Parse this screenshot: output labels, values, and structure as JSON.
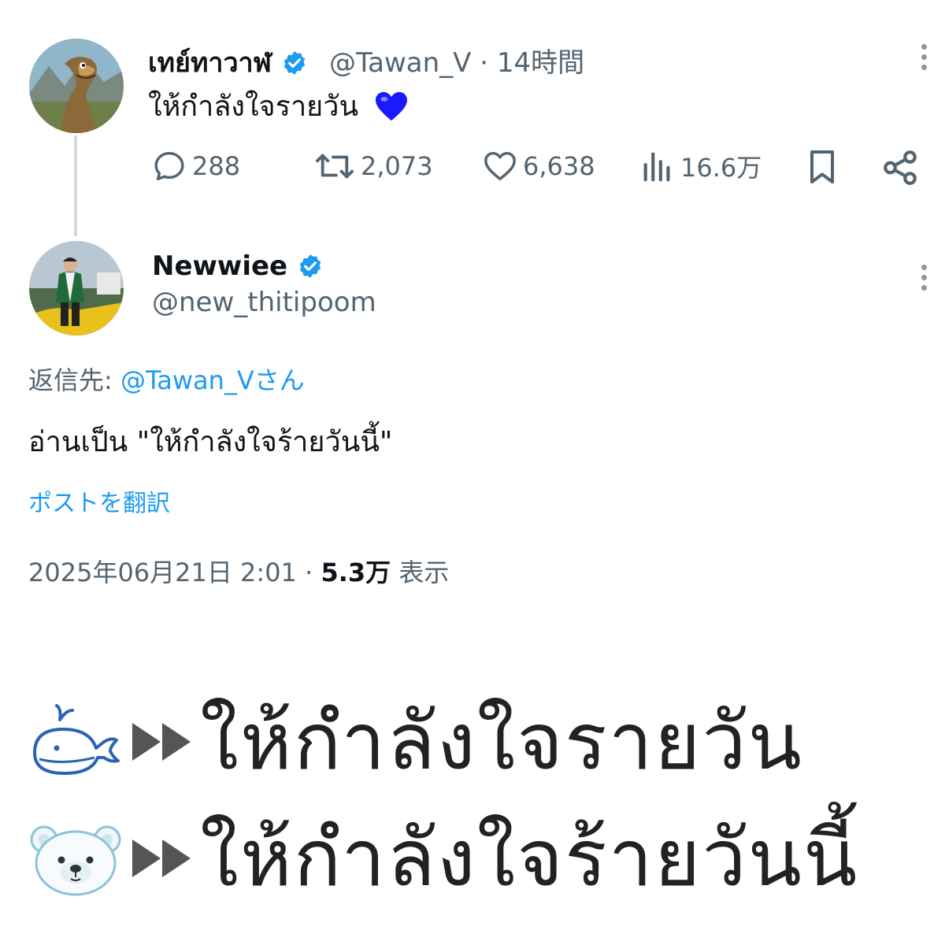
{
  "colors": {
    "accent": "#1d9bf0",
    "muted": "#536471",
    "text": "#0f1419",
    "heart": "#1a1aff"
  },
  "tweet1": {
    "display_name": "เทย์ทาวาฬ",
    "handle": "@Tawan_V",
    "separator": "·",
    "time": "14時間",
    "text": "ให้กำลังใจรายวัน",
    "emoji_icon": "blue-heart-icon",
    "actions": {
      "replies": "288",
      "reposts": "2,073",
      "likes": "6,638",
      "views": "16.6万"
    }
  },
  "tweet2": {
    "display_name": "Newwiee",
    "handle": "@new_thitipoom",
    "reply_prefix": "返信先:",
    "reply_to": "@Tawan_Vさん",
    "text": "อ่านเป็น \"ให้กำลังใจร้ายวันนี้\"",
    "translate_label": "ポストを翻訳",
    "timestamp": "2025年06月21日 2:01",
    "separator": "·",
    "views_count": "5.3万",
    "views_label": "表示"
  },
  "attached_image": {
    "rows": [
      {
        "icon": "whale-icon",
        "arrow": "fast-forward-icon",
        "text": "ให้กำลังใจรายวัน"
      },
      {
        "icon": "polar-bear-icon",
        "arrow": "fast-forward-icon",
        "text": "ให้กำลังใจร้ายวันนี้"
      }
    ]
  }
}
